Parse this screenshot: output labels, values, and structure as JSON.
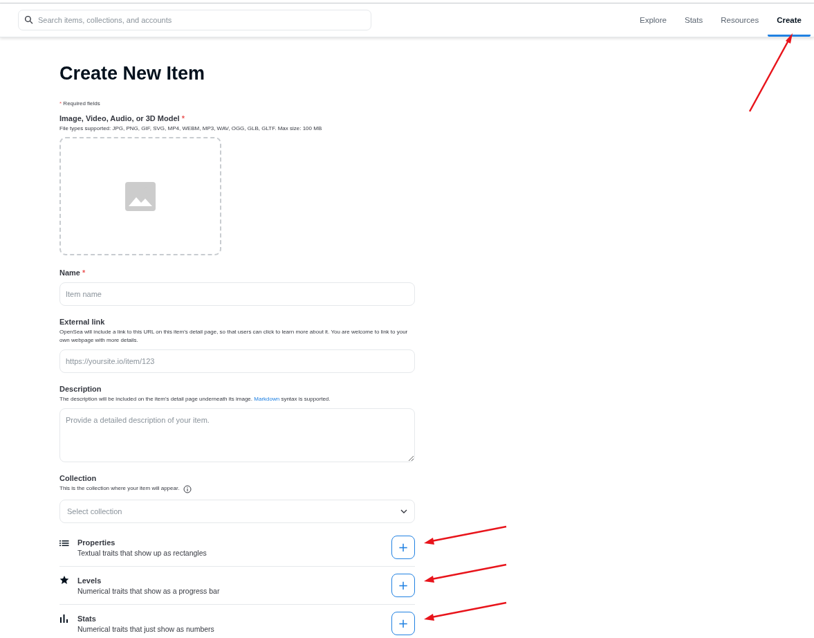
{
  "header": {
    "search": {
      "placeholder": "Search items, collections, and accounts"
    },
    "nav": [
      {
        "label": "Explore",
        "selected": false,
        "marked": false
      },
      {
        "label": "Stats",
        "selected": false,
        "marked": false
      },
      {
        "label": "Resources",
        "selected": false,
        "marked": false
      },
      {
        "label": "Create",
        "selected": true,
        "marked": true
      }
    ]
  },
  "page": {
    "title": "Create New Item",
    "required_note": {
      "mark": "*",
      "text": "Required fields"
    },
    "media": {
      "label": "Image, Video, Audio, or 3D Model",
      "required": true,
      "hint": "File types supported: JPG, PNG, GIF, SVG, MP4, WEBM, MP3, WAV, OGG, GLB, GLTF. Max size: 100 MB"
    },
    "fields": [
      {
        "kind": "input",
        "label": "Name",
        "required": true,
        "placeholder": "Item name"
      },
      {
        "kind": "input",
        "label": "External link",
        "required": false,
        "hint": "OpenSea will include a link to this URL on this item's detail page, so that users can click to learn more about it. You are welcome to link to your own webpage with more details.",
        "placeholder": "https://yoursite.io/item/123"
      },
      {
        "kind": "textarea",
        "label": "Description",
        "required": false,
        "hint": "The description will be included on the item's detail page underneath its image.",
        "hint_link": "Markdown",
        "hint_end": "syntax is supported.",
        "placeholder": "Provide a detailed description of your item."
      },
      {
        "kind": "select",
        "label": "Collection",
        "required": false,
        "hint": "This is the collection where your item will appear.",
        "info": true,
        "placeholder": "Select collection"
      }
    ],
    "traits": [
      {
        "kind": "list",
        "title": "Properties",
        "description": "Textual traits that show up as rectangles",
        "button": "+",
        "marked": true
      },
      {
        "kind": "star",
        "title": "Levels",
        "description": "Numerical traits that show as a progress bar",
        "button": "+",
        "marked": true
      },
      {
        "kind": "bars",
        "title": "Stats",
        "description": "Numerical traits that just show as numbers",
        "button": "+",
        "marked": true
      }
    ]
  }
}
